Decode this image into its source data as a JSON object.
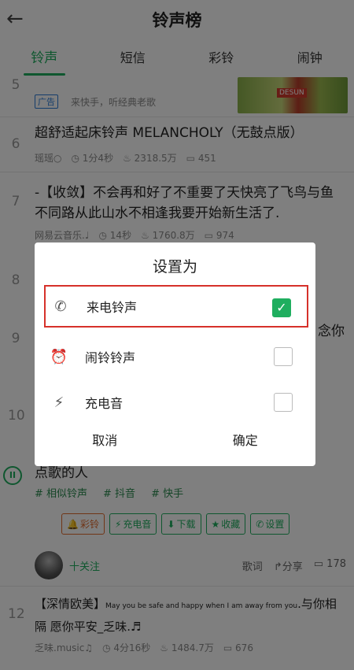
{
  "header": {
    "title": "铃声榜",
    "back_icon": "arrow-left-icon"
  },
  "tabs": [
    {
      "label": "铃声",
      "active": true
    },
    {
      "label": "短信",
      "active": false
    },
    {
      "label": "彩铃",
      "active": false
    },
    {
      "label": "闹钟",
      "active": false
    }
  ],
  "list": {
    "row5": {
      "num": "5",
      "ad_badge": "广告",
      "ad_text": "来快手，听经典老歌",
      "ad_tag": "DESUN"
    },
    "row6": {
      "num": "6",
      "title": "超舒适起床铃声 MELANCHOLY（无鼓点版）",
      "author": "瑶瑶○",
      "duration": "1分4秒",
      "plays": "2318.5万",
      "likes": "451"
    },
    "row7": {
      "num": "7",
      "title": "-【收敛】不会再和好了不重要了天快亮了飞鸟与鱼不同路从此山水不相逢我要开始新生活了.",
      "author": "网易云音乐.♩",
      "duration": "14秒",
      "plays": "1760.8万",
      "likes": "974"
    },
    "row8": {
      "num": "8"
    },
    "row9": {
      "num": "9",
      "trailing": "念你"
    },
    "row10": {
      "num": "10"
    },
    "row11": {
      "title": "点歌的人",
      "tags": [
        "# 相似铃声",
        "# 抖音",
        "# 快手"
      ],
      "actions": [
        "彩铃",
        "充电音",
        "下载",
        "收藏",
        "设置"
      ],
      "follow": "十关注",
      "lyrics": "歌词",
      "share": "分享",
      "comments": "178"
    },
    "row12": {
      "num": "12",
      "title_prefix": "【深情欧美】",
      "title_en": "May you be safe and happy when I am away from you",
      "title_suffix": ".与你相隔 愿你平安_乏味.♬",
      "author": "乏味.music♫",
      "duration": "4分16秒",
      "plays": "1484.7万",
      "likes": "676"
    }
  },
  "dialog": {
    "title": "设置为",
    "options": [
      {
        "label": "来电铃声",
        "icon": "phone-icon",
        "checked": true
      },
      {
        "label": "闹铃铃声",
        "icon": "alarm-clock-icon",
        "checked": false
      },
      {
        "label": "充电音",
        "icon": "charging-icon",
        "checked": false
      }
    ],
    "cancel": "取消",
    "confirm": "确定"
  },
  "colors": {
    "accent": "#1fae5f",
    "highlight": "#d6312a",
    "orange": "#e06a2d"
  }
}
